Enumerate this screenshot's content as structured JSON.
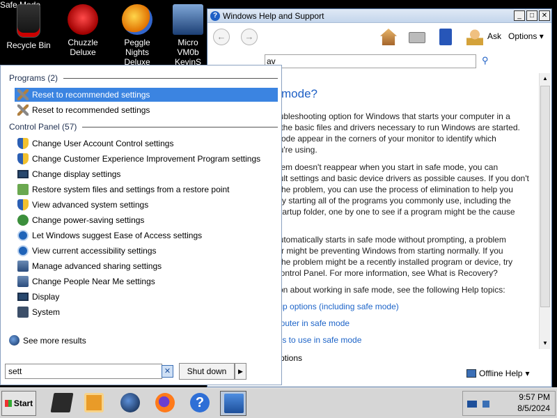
{
  "desktop": {
    "safe_mode_label": "Safe Mode",
    "icons": [
      {
        "label": "Recycle Bin",
        "icon": "recycle-bin-icon"
      },
      {
        "label": "Chuzzle Deluxe",
        "icon": "chuzzle-icon"
      },
      {
        "label": "Peggle Nights Deluxe",
        "icon": "peggle-icon"
      },
      {
        "label": "Micro VM0b KevinS",
        "icon": "vm-icon"
      }
    ]
  },
  "help_window": {
    "title": "Windows Help and Support",
    "buttons": {
      "ask": "Ask",
      "options": "Options"
    },
    "search_value": "av",
    "heading": "mode?",
    "paragraphs": [
      "oubleshooting option for Windows that starts your computer in a",
      "y the basic files and drivers necessary to run Windows are started.",
      "Mode appear in the corners of your monitor to identify which",
      "ou're using.",
      "blem doesn't reappear when you start in safe mode, you can",
      "ault settings and basic device drivers as possible causes. If you don't",
      "f the problem, you can use the process of elimination to help you",
      " Try starting all of the programs you commonly use, including the",
      " Startup folder, one by one to see if a program might be the cause",
      "automatically starts in safe mode without prompting, a problem",
      "ter might be preventing Windows from starting normally. If you",
      "f the problem might be a recently installed program or device, try",
      " Control Panel. For more information, see What is Recovery?",
      "tion about working in safe mode, see the following Help topics:"
    ],
    "links": [
      "tup options (including safe mode)",
      "nputer in safe mode",
      "ols to use in safe mode"
    ],
    "options_label": "ptions",
    "offline_help": "Offline Help"
  },
  "start_menu": {
    "programs_header": "Programs (2)",
    "programs": [
      {
        "label": "Reset to recommended settings",
        "selected": true
      },
      {
        "label": "Reset to recommended settings",
        "selected": false
      }
    ],
    "control_panel_header": "Control Panel (57)",
    "control_panel": [
      {
        "label": "Change User Account Control settings",
        "icon": "shield-icon"
      },
      {
        "label": "Change Customer Experience Improvement Program settings",
        "icon": "shield-icon"
      },
      {
        "label": "Change display settings",
        "icon": "monitor-icon"
      },
      {
        "label": "Restore system files and settings from a restore point",
        "icon": "restore-icon"
      },
      {
        "label": "View advanced system settings",
        "icon": "shield-icon"
      },
      {
        "label": "Change power-saving settings",
        "icon": "power-icon"
      },
      {
        "label": "Let Windows suggest Ease of Access settings",
        "icon": "ease-of-access-icon"
      },
      {
        "label": "View current accessibility settings",
        "icon": "ease-of-access-icon"
      },
      {
        "label": "Manage advanced sharing settings",
        "icon": "network-icon"
      },
      {
        "label": "Change People Near Me settings",
        "icon": "network-icon"
      },
      {
        "label": "Display",
        "icon": "monitor-icon"
      },
      {
        "label": "System",
        "icon": "system-icon"
      }
    ],
    "see_more": "See more results",
    "search_value": "sett",
    "shutdown_label": "Shut down"
  },
  "taskbar": {
    "start_label": "Start",
    "clock_time": "9:57 PM",
    "clock_date": "8/5/2024"
  }
}
